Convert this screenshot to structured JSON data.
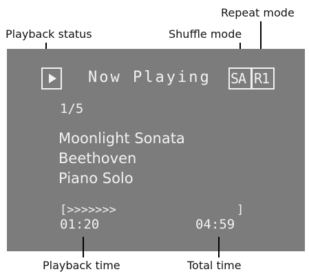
{
  "callouts": {
    "playback_status": "Playback status",
    "shuffle_mode": "Shuffle mode",
    "repeat_mode": "Repeat mode",
    "playback_time": "Playback time",
    "total_time": "Total time"
  },
  "screen": {
    "header": "Now Playing",
    "shuffle_indicator": "SA",
    "repeat_indicator": "R1",
    "track_position": "1/5",
    "title": "Moonlight Sonata",
    "artist": "Beethoven",
    "album": "Piano Solo",
    "progress_bar": "[>>>>>>>",
    "progress_end": "]",
    "elapsed_time": "01:20",
    "total_time": "04:59"
  },
  "colors": {
    "screen_background": "#7c7c7c",
    "screen_text": "#f2f2f2",
    "callout_text": "#111111",
    "leader_lines": "#000000"
  },
  "icons": {
    "status": "play-icon"
  }
}
